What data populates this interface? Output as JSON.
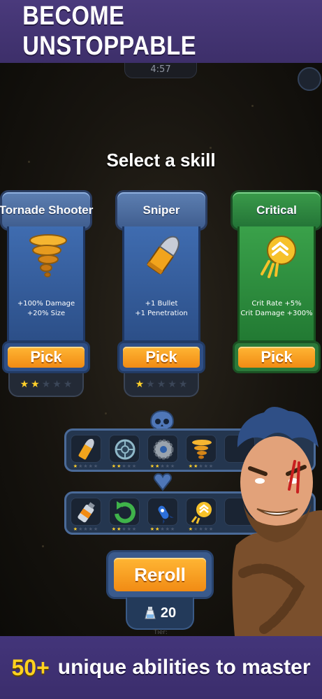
{
  "banner": {
    "title": "BECOME UNSTOPPABLE"
  },
  "hud": {
    "timer": "4:57"
  },
  "screen": {
    "title": "Select a skill"
  },
  "cards": [
    {
      "name": "Tornade Shooter",
      "desc_1": "+100% Damage",
      "desc_2": "+20% Size",
      "pick": "Pick",
      "stars": 2,
      "max_stars": 5,
      "icon": "tornado-icon"
    },
    {
      "name": "Sniper",
      "desc_1": "+1 Bullet",
      "desc_2": "+1 Penetration",
      "pick": "Pick",
      "stars": 1,
      "max_stars": 5,
      "icon": "bullet-icon"
    },
    {
      "name": "Critical",
      "desc_1": "Crit Rate +5%",
      "desc_2": "Crit Damage +300%",
      "pick": "Pick",
      "stars": 0,
      "max_stars": 5,
      "icon": "crit-arrows-icon"
    }
  ],
  "equipped_weapons": [
    {
      "icon": "bullet-icon",
      "stars": 1
    },
    {
      "icon": "crosshair-icon",
      "stars": 2
    },
    {
      "icon": "sawblade-icon",
      "stars": 2
    },
    {
      "icon": "tornado-icon",
      "stars": 2
    }
  ],
  "equipped_passives": [
    {
      "icon": "ammo-bottle-icon",
      "stars": 1
    },
    {
      "icon": "recycle-arrow-icon",
      "stars": 2
    },
    {
      "icon": "rocket-icon",
      "stars": 2
    },
    {
      "icon": "crit-arrows-icon",
      "stars": 1
    }
  ],
  "reroll": {
    "label": "Reroll",
    "gem_count": "20",
    "tier_label": "Tier:"
  },
  "footer": {
    "count": "50+",
    "tagline": "unique abilities to master"
  },
  "colors": {
    "banner": "#3d2f6a",
    "pick_orange": "#f7a01f",
    "card_blue": "#3f6cb0",
    "card_green": "#2e8a40",
    "star_gold": "#ffd02a",
    "footer_yellow": "#ffd21f"
  }
}
